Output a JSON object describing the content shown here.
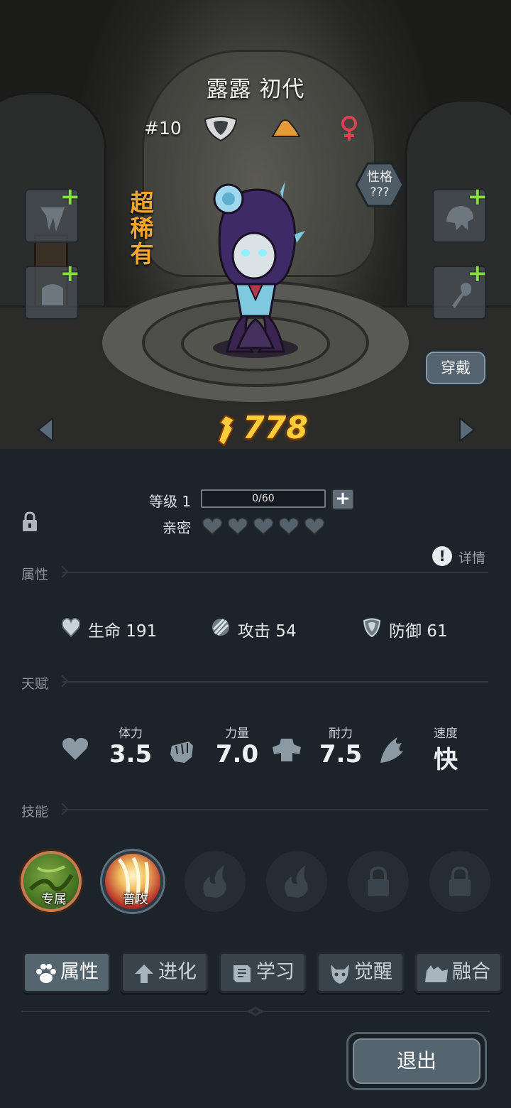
{
  "character": {
    "name": "露露 初代",
    "number": "#10",
    "rarity": "超稀有",
    "personality_label": "性格",
    "personality_value": "???",
    "power": "778",
    "wear_button": "穿戴"
  },
  "level": {
    "label": "等级 1",
    "progress_text": "0/60",
    "progress_fraction": 0,
    "intimacy_label": "亲密",
    "intimacy_hearts_total": 5,
    "intimacy_hearts_filled": 0
  },
  "detail_label": "详情",
  "attributes": {
    "title": "属性",
    "hp": "生命  191",
    "attack": "攻击  54",
    "defense": "防御  61"
  },
  "talents": {
    "title": "天赋",
    "items": [
      {
        "label": "体力",
        "value": "3.5"
      },
      {
        "label": "力量",
        "value": "7.0"
      },
      {
        "label": "耐力",
        "value": "7.5"
      },
      {
        "label": "速度",
        "value": "快"
      }
    ]
  },
  "skills": {
    "title": "技能",
    "slots": [
      {
        "label": "专属"
      },
      {
        "label": "普攻"
      }
    ]
  },
  "tabs": [
    {
      "label": "属性"
    },
    {
      "label": "进化"
    },
    {
      "label": "学习"
    },
    {
      "label": "觉醒"
    },
    {
      "label": "融合"
    }
  ],
  "exit_button": "退出",
  "colors": {
    "rarity": "#f4a52c",
    "power": "#ffcc3a",
    "plus": "#86df3a",
    "female": "#e0404f",
    "panel_bg": "#1c2329"
  }
}
